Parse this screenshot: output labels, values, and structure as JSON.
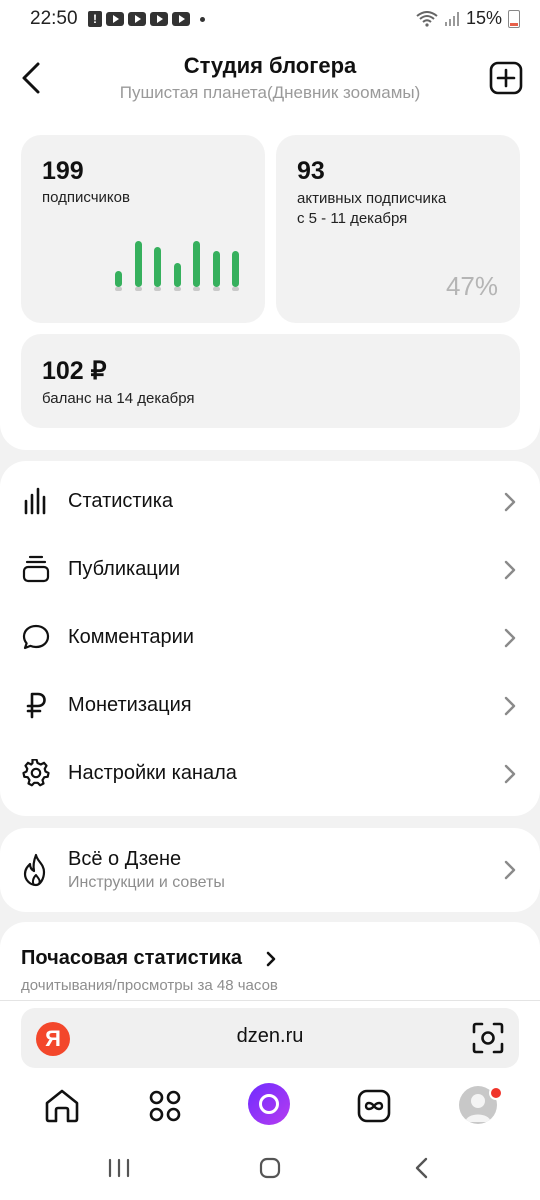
{
  "status_bar": {
    "time": "22:50",
    "battery": "15%"
  },
  "header": {
    "title": "Студия блогера",
    "subtitle": "Пушистая планета(Дневник зоомамы)"
  },
  "cards": {
    "subscribers": {
      "value": "199",
      "label": "подписчиков"
    },
    "active": {
      "value": "93",
      "label_line1": "активных подписчика",
      "label_line2": "с 5 - 11 декабря",
      "percent": "47%"
    },
    "balance": {
      "value": "102 ₽",
      "label": "баланс на 14 декабря"
    }
  },
  "chart_data": {
    "type": "bar",
    "values": [
      8,
      23,
      20,
      12,
      23,
      18,
      18
    ],
    "colors": {
      "bar": "#36b05d",
      "base": "#c9c9c9"
    }
  },
  "menu": {
    "items": [
      {
        "label": "Статистика",
        "icon": "stats-bars-icon"
      },
      {
        "label": "Публикации",
        "icon": "publications-stack-icon"
      },
      {
        "label": "Комментарии",
        "icon": "comment-bubble-icon"
      },
      {
        "label": "Монетизация",
        "icon": "ruble-icon"
      },
      {
        "label": "Настройки канала",
        "icon": "gear-icon"
      }
    ]
  },
  "zen": {
    "title": "Всё о Дзене",
    "subtitle": "Инструкции и советы"
  },
  "hourly": {
    "title": "Почасовая статистика",
    "subtitle": "дочитывания/просмотры за 48 часов"
  },
  "address_bar": {
    "logo": "Я",
    "url": "dzen.ru"
  },
  "colors": {
    "accent_green": "#36b05d",
    "yandex_red": "#f3472b",
    "alice_purple": "#7b2cff",
    "notification_red": "#f0342a"
  }
}
